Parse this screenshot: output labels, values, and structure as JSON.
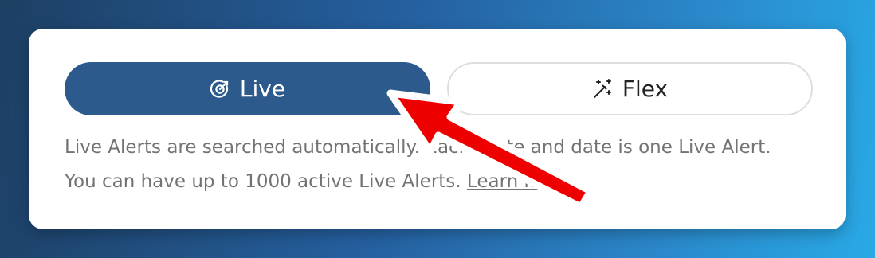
{
  "toggle": {
    "live_label": "Live",
    "live_icon": "target-icon",
    "flex_label": "Flex",
    "flex_icon": "magic-wand-icon",
    "active": "live",
    "active_color": "#2c5a8c"
  },
  "description": {
    "text": "Live Alerts are searched automatically. Each route and date is one Live Alert. You can have up to 1000 active Live Alerts.",
    "link_label": "Learn more."
  },
  "annotation": {
    "arrow_color": "#ee0000"
  }
}
